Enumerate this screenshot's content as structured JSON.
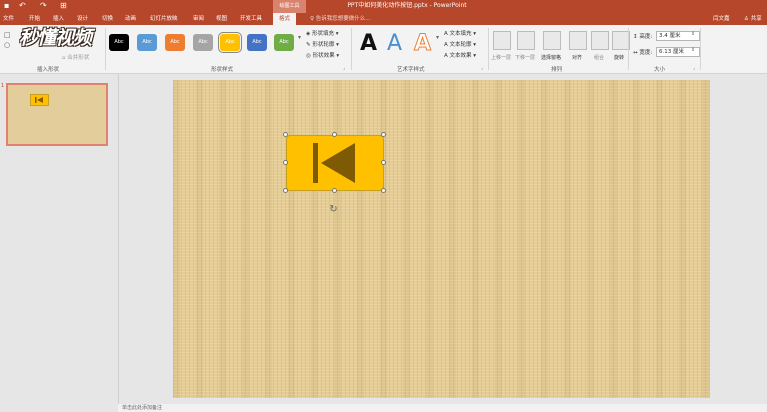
{
  "window": {
    "title": "PPT中如何美化动作按钮.pptx - PowerPoint",
    "context_group": "绘图工具",
    "user_name": "闫文嘉",
    "share_label": "共享",
    "tell_me": "告诉我您想要做什么..."
  },
  "tabs": [
    "文件",
    "开始",
    "插入",
    "设计",
    "切换",
    "动画",
    "幻灯片放映",
    "审阅",
    "视图",
    "开发工具",
    "格式"
  ],
  "active_tab": "格式",
  "watermark_logo": "秒懂视频",
  "ribbon": {
    "insert_shapes": {
      "label": "插入形状",
      "merge_shapes": "合并形状"
    },
    "shape_styles": {
      "label": "形状样式",
      "style_label": "Abc",
      "styles": [
        {
          "color": "#000000"
        },
        {
          "color": "#5b9bd5"
        },
        {
          "color": "#ed7d31"
        },
        {
          "color": "#a5a5a5"
        },
        {
          "color": "#ffc000"
        },
        {
          "color": "#4472c4"
        },
        {
          "color": "#70ad47"
        }
      ],
      "fill": "形状填充",
      "outline": "形状轮廓",
      "effects": "形状效果"
    },
    "wordart_styles": {
      "label": "艺术字样式",
      "letters": [
        {
          "char": "A",
          "color": "#111111"
        },
        {
          "char": "A",
          "color": "#4a8fd1"
        },
        {
          "char": "A",
          "color": "#ed7d31"
        }
      ],
      "text_fill": "文本填充",
      "text_outline": "文本轮廓",
      "text_effects": "文本效果"
    },
    "arrange": {
      "label": "排列",
      "buttons": [
        "上移一层",
        "下移一层",
        "选择窗格",
        "对齐",
        "组合",
        "旋转"
      ]
    },
    "size": {
      "label": "大小",
      "height_label": "高度:",
      "height_value": "3.4 厘米",
      "width_label": "宽度:",
      "width_value": "6.13 厘米"
    }
  },
  "slides_panel": {
    "slide_number": "1"
  },
  "status_text": "单击此处添加备注"
}
